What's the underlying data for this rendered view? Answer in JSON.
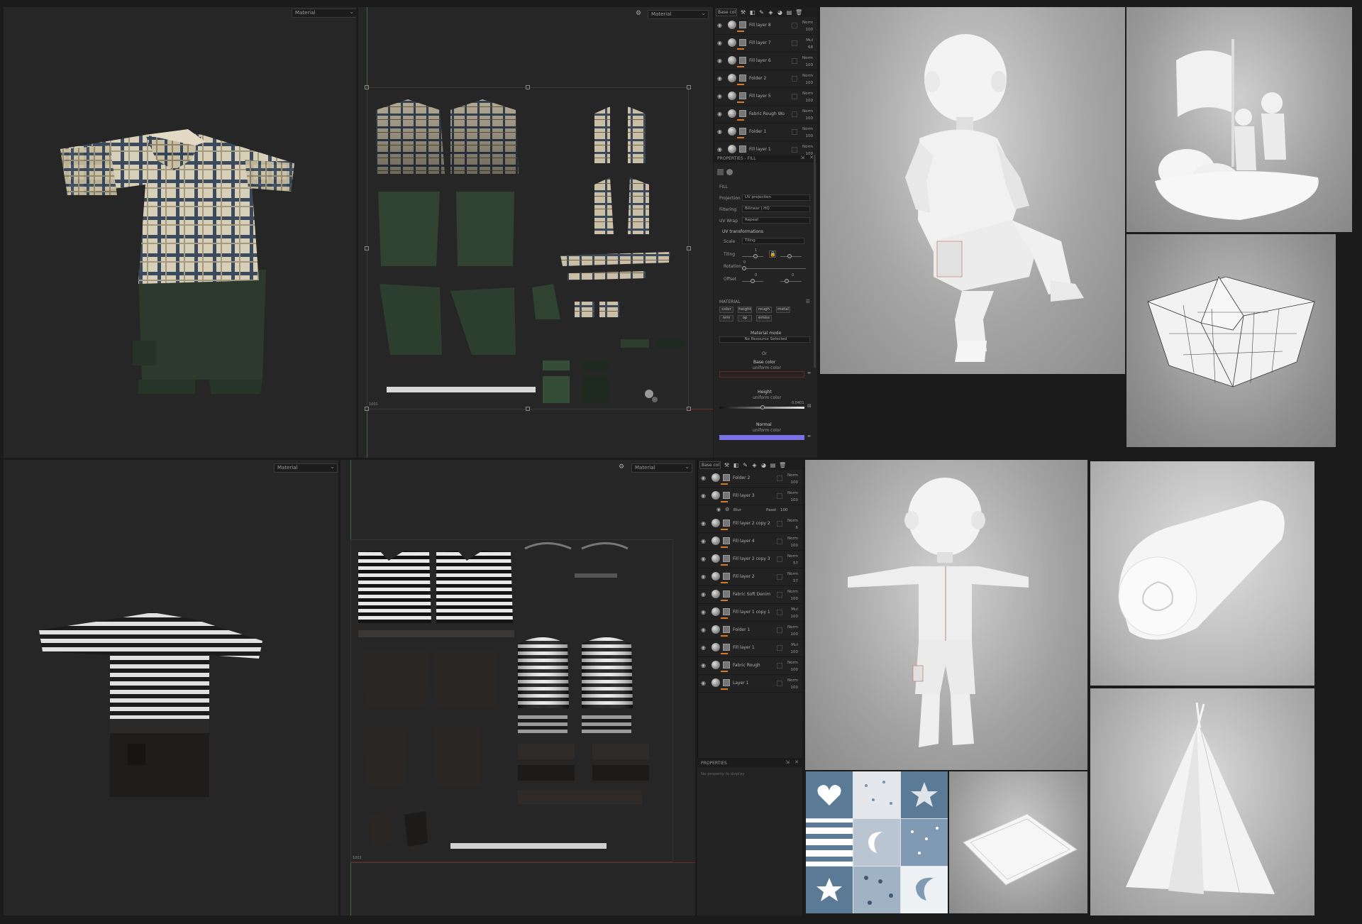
{
  "top_section": {
    "viewport3d": {
      "view_mode": "Material"
    },
    "uv_view": {
      "view_mode": "Material",
      "uv_tile": "1001"
    },
    "layers": {
      "channel": "Base col",
      "items": [
        {
          "name": "Fill layer 8",
          "blend": "Norm",
          "opacity": "100"
        },
        {
          "name": "Fill layer 7",
          "blend": "Mul",
          "opacity": "68"
        },
        {
          "name": "Fill layer 6",
          "blend": "Norm",
          "opacity": "100"
        },
        {
          "name": "Folder 2",
          "blend": "Norm",
          "opacity": "100"
        },
        {
          "name": "Fill layer 5",
          "blend": "Norm",
          "opacity": "100"
        },
        {
          "name": "Fabric Rough Wo",
          "blend": "Norm",
          "opacity": "100"
        },
        {
          "name": "Folder 1",
          "blend": "Norm",
          "opacity": "100"
        },
        {
          "name": "Fill layer 1",
          "blend": "Norm",
          "opacity": "100"
        }
      ]
    },
    "properties": {
      "title": "PROPERTIES - FILL",
      "fill_label": "FILL",
      "projection_label": "Projection",
      "projection_value": "UV projection",
      "filtering_label": "Filtering",
      "filtering_value": "Bilinear | HQ",
      "uvwrap_label": "UV Wrap",
      "uvwrap_value": "Repeat",
      "uvtrans_label": "UV transformations",
      "scale_label": "Scale",
      "scale_value": "Tiling",
      "tiling_label": "Tiling",
      "tiling_value": "1",
      "rotation_label": "Rotation",
      "rotation_value": "0",
      "offset_label": "Offset",
      "offset_value_1": "0",
      "offset_value_2": "0",
      "material_label": "MATERIAL",
      "channels": [
        "color",
        "height",
        "rough",
        "metal",
        "nrm",
        "op",
        "emiss"
      ],
      "material_mode_label": "Material mode",
      "material_mode_value": "No Resource Selected",
      "or_label": "Or",
      "base_color_label": "Base color",
      "base_color_value": "uniform color",
      "height_label": "Height",
      "height_value": "uniform color",
      "height_number": "0.0401",
      "normal_label": "Normal",
      "normal_value": "uniform color"
    }
  },
  "bottom_section": {
    "viewport3d": {
      "view_mode": "Material"
    },
    "uv_view": {
      "view_mode": "Material",
      "uv_tile": "1001"
    },
    "layers": {
      "channel": "Base col",
      "items": [
        {
          "name": "Folder 2",
          "blend": "Norm",
          "opacity": "100"
        },
        {
          "name": "Fill layer 3",
          "blend": "Norm",
          "opacity": "100"
        },
        {
          "name": "Fill layer 2 copy 2",
          "blend": "Norm",
          "opacity": "6"
        },
        {
          "name": "Fill layer 4",
          "blend": "Norm",
          "opacity": "100"
        },
        {
          "name": "Fill layer 2 copy 3",
          "blend": "Norm",
          "opacity": "57"
        },
        {
          "name": "Fill layer 2",
          "blend": "Norm",
          "opacity": "57"
        },
        {
          "name": "Fabric Soft Denim",
          "blend": "Norm",
          "opacity": "100"
        },
        {
          "name": "Fill layer 1 copy 1",
          "blend": "Mul",
          "opacity": "100"
        },
        {
          "name": "Folder 1",
          "blend": "Norm",
          "opacity": "100"
        },
        {
          "name": "Fill layer 1",
          "blend": "Mul",
          "opacity": "100"
        },
        {
          "name": "Fabric Rough",
          "blend": "Norm",
          "opacity": "100"
        },
        {
          "name": "Layer 1",
          "blend": "Norm",
          "opacity": "100"
        }
      ],
      "effect_name": "Blur",
      "effect_blend": "Passt",
      "effect_value": "100"
    },
    "properties": {
      "title": "PROPERTIES",
      "hint": "No property to display"
    }
  },
  "renders": {
    "top_character": "boy-sitting-render",
    "top_right": "boys-on-raft-render",
    "paper_boat": "paper-boat-wireframe",
    "bottom_character": "boy-tpose-render",
    "pillow_roll": "rolled-blanket-render",
    "teepee": "teepee-tent-render",
    "quilt": "patchwork-quilt",
    "pillow": "pillow-render"
  },
  "colors": {
    "accent_orange": "#d97a20",
    "normal_blue": "#7b72e8",
    "quilt_blue": "#5a7a96"
  }
}
